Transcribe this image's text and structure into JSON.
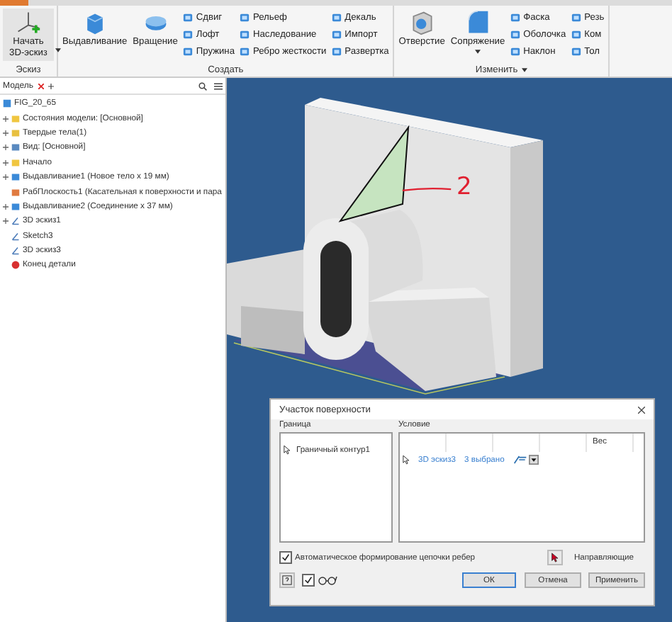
{
  "ribbon": {
    "groups": [
      {
        "label": "Эскиз",
        "menu": false,
        "large": [
          {
            "label": "Начать 3D-эскиз",
            "kind": "sketch3d",
            "dropdown": true
          }
        ]
      },
      {
        "label": "Создать",
        "menu": false,
        "large": [
          {
            "label": "Выдавливание",
            "kind": "extrude",
            "dropdown": false
          },
          {
            "label": "Вращение",
            "kind": "revolve",
            "dropdown": false
          }
        ],
        "small": [
          [
            "Сдвиг",
            "Лофт",
            "Пружина"
          ],
          [
            "Рельеф",
            "Наследование",
            "Ребро жесткости"
          ],
          [
            "Декаль",
            "Импорт",
            "Развертка"
          ]
        ]
      },
      {
        "label": "Изменить",
        "menu": true,
        "large": [
          {
            "label": "Отверстие",
            "kind": "hole",
            "dropdown": false
          },
          {
            "label": "Сопряжение",
            "kind": "fillet",
            "dropdown": true
          }
        ],
        "small": [
          [
            "Фаска",
            "Оболочка",
            "Наклон"
          ],
          [
            "Резь",
            "Ком",
            "Тол"
          ]
        ]
      }
    ]
  },
  "browser": {
    "tab": "Модель",
    "tree": [
      {
        "label": "FIG_20_65",
        "kind": "part",
        "children": [
          {
            "label": "Состояния модели: [Основной]",
            "kind": "folder",
            "expandable": true
          },
          {
            "label": "Твердые тела(1)",
            "kind": "bodies",
            "expandable": true
          },
          {
            "label": "Вид: [Основной]",
            "kind": "view",
            "expandable": true
          },
          {
            "label": "Начало",
            "kind": "folder",
            "expandable": true
          },
          {
            "label": "Выдавливание1 (Новое тело x 19 мм)",
            "kind": "extrude",
            "expandable": true
          },
          {
            "label": "РабПлоскость1 (Касательная к поверхности и пара",
            "kind": "plane",
            "expandable": false
          },
          {
            "label": "Выдавливание2 (Соединение x 37 мм)",
            "kind": "extrude",
            "expandable": true
          },
          {
            "label": "3D эскиз1",
            "kind": "sketch3d",
            "expandable": true
          },
          {
            "label": "Sketch3",
            "kind": "sketch",
            "expandable": false
          },
          {
            "label": "3D эскиз3",
            "kind": "sketch3d",
            "expandable": false
          },
          {
            "label": "Конец детали",
            "kind": "end",
            "expandable": false
          }
        ]
      }
    ]
  },
  "annotation": {
    "text": "2"
  },
  "dialog": {
    "title": "Участок поверхности",
    "boundary": {
      "label": "Граница",
      "items": [
        "Граничный контур1"
      ]
    },
    "condition": {
      "label": "Условие",
      "weight_column": "Вес",
      "rows": [
        {
          "sketch": "3D эскиз3",
          "selection": "3 выбрано"
        }
      ]
    },
    "auto_chain": {
      "label": "Автоматическое формирование цепочки ребер",
      "checked": true
    },
    "guides_button": "Направляющие",
    "preview": {
      "checked": true
    },
    "buttons": [
      {
        "label": "ОК",
        "default": true
      },
      {
        "label": "Отмена",
        "default": false
      },
      {
        "label": "Применить",
        "default": false
      }
    ]
  }
}
